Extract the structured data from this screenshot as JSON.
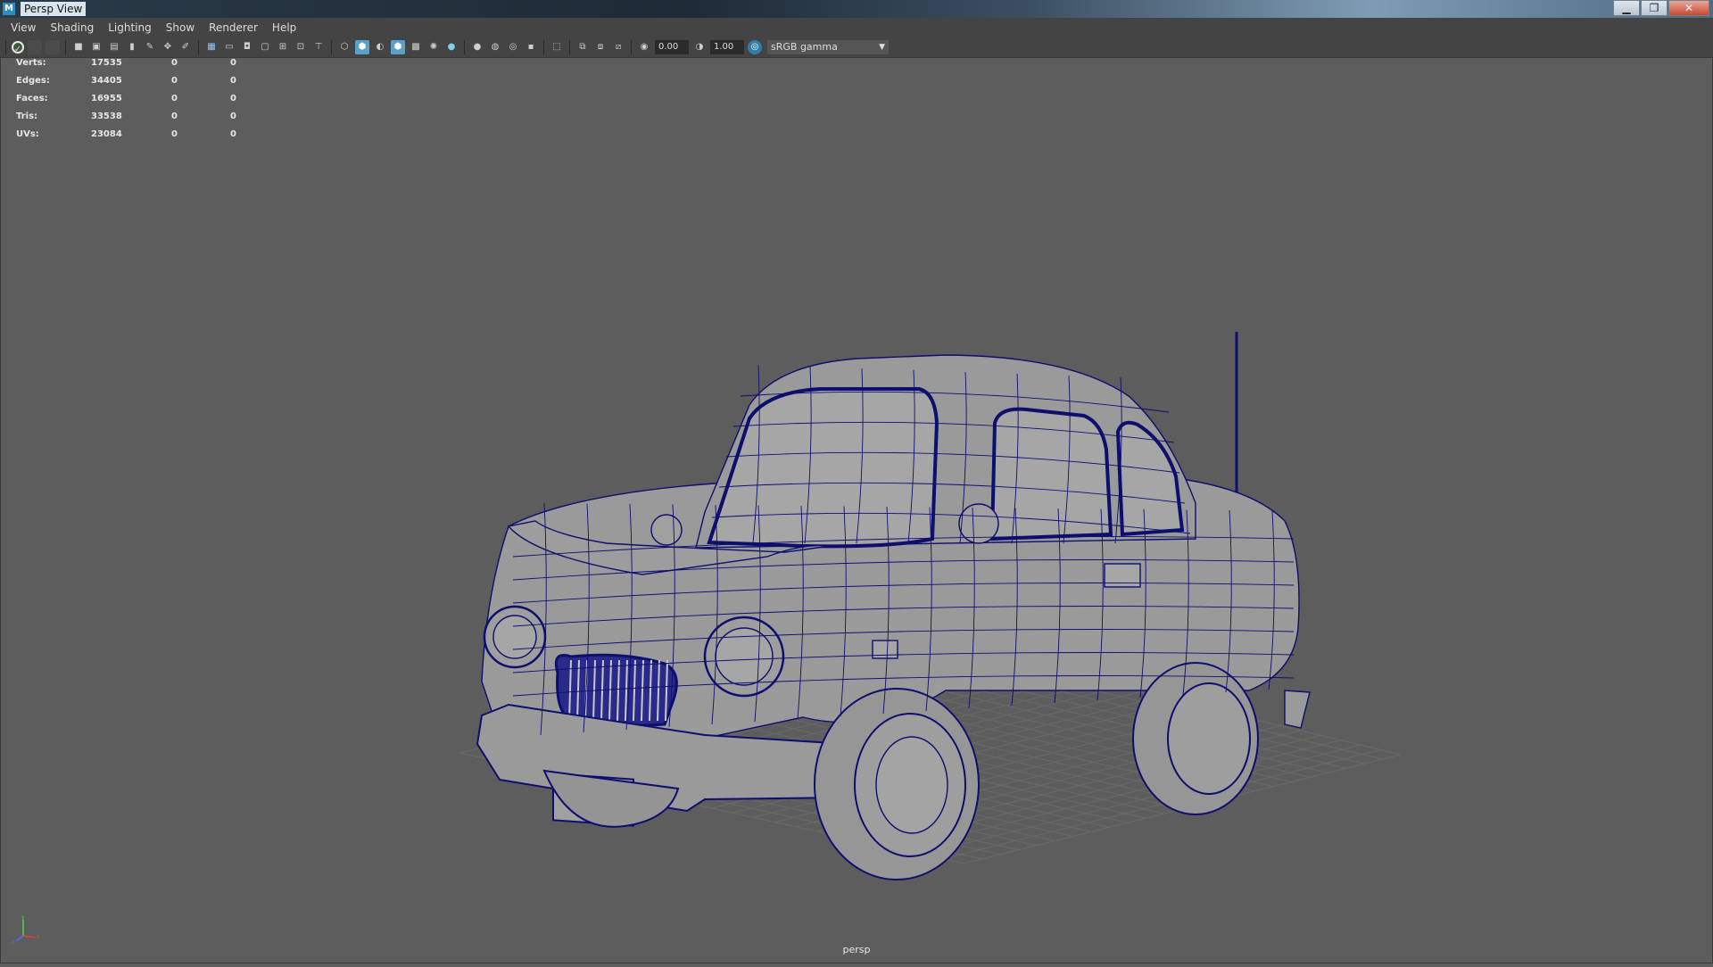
{
  "window": {
    "app_icon": "M",
    "title": "Persp View",
    "controls": {
      "minimize": "▁",
      "maximize": "❐",
      "close": "✕"
    }
  },
  "menubar": [
    "View",
    "Shading",
    "Lighting",
    "Show",
    "Renderer",
    "Help"
  ],
  "toolbar": {
    "exposure_value": "0.00",
    "gamma_value": "1.00",
    "color_space": "sRGB gamma"
  },
  "hud": [
    {
      "label": "Verts:",
      "values": [
        "17535",
        "0",
        "0"
      ]
    },
    {
      "label": "Edges:",
      "values": [
        "34405",
        "0",
        "0"
      ]
    },
    {
      "label": "Faces:",
      "values": [
        "16955",
        "0",
        "0"
      ]
    },
    {
      "label": "Tris:",
      "values": [
        "33538",
        "0",
        "0"
      ]
    },
    {
      "label": "UVs:",
      "values": [
        "23084",
        "0",
        "0"
      ]
    }
  ],
  "viewport": {
    "camera_label": "persp",
    "axis": {
      "x": "x",
      "y": "y",
      "z": "z"
    },
    "wire_color": "#0d0e6e",
    "mesh_color": "#9a9a9a",
    "background": "#5d5d5d"
  }
}
